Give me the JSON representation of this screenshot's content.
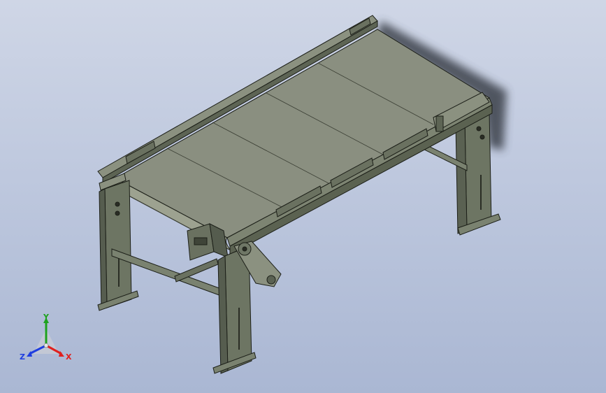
{
  "viewport": {
    "background_top": "#cfd6e6",
    "background_bottom": "#aab7d3"
  },
  "model": {
    "frame_color": "#6f7766",
    "belt_color": "#8a8f80",
    "edge_color": "#1c1f18"
  },
  "triad": {
    "x_label": "X",
    "y_label": "Y",
    "z_label": "Z",
    "x_color": "#e0201e",
    "y_color": "#1ea21e",
    "z_color": "#1f3ee0"
  }
}
